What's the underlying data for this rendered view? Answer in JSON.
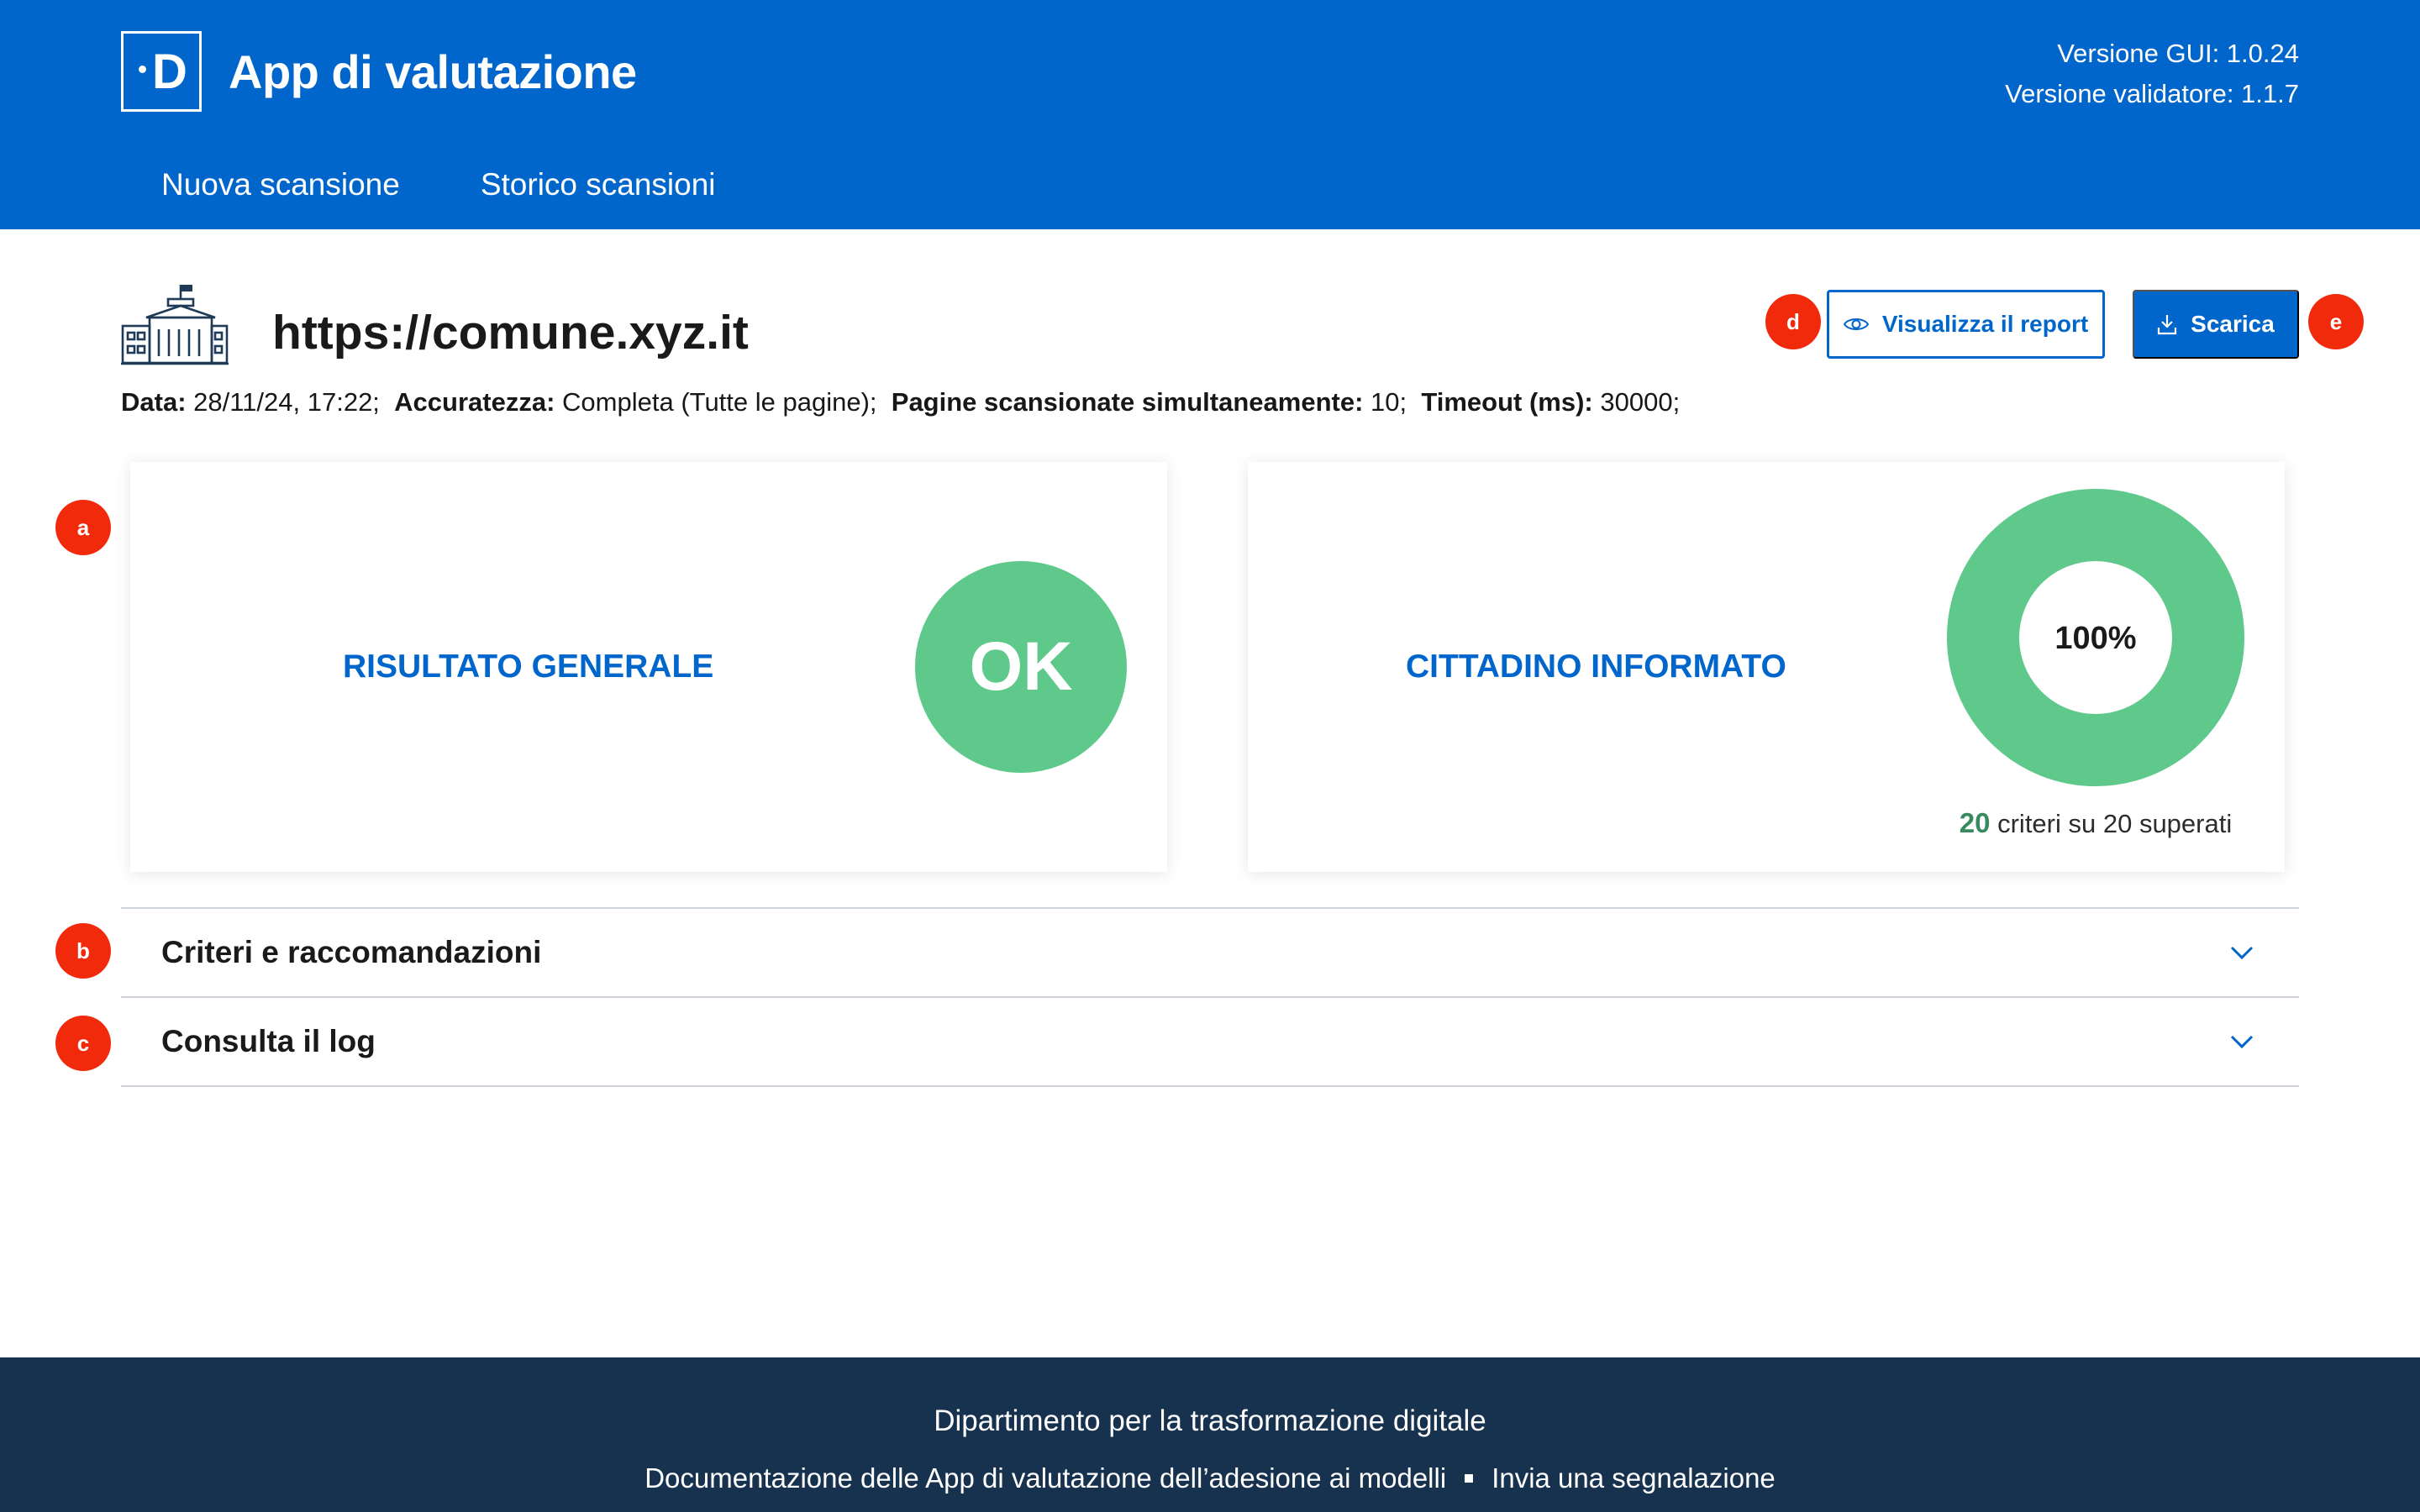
{
  "header": {
    "logo_letter": "D",
    "app_title": "App di valutazione",
    "gui_version": "Versione GUI: 1.0.24",
    "validator_version": "Versione validatore: 1.1.7",
    "nav": [
      {
        "label": "Nuova scansione"
      },
      {
        "label": "Storico scansioni"
      }
    ]
  },
  "scan": {
    "url": "https://comune.xyz.it",
    "meta": {
      "date_label": "Data:",
      "date_value": "28/11/24, 17:22;",
      "accuracy_label": "Accuratezza:",
      "accuracy_value": "Completa (Tutte le pagine);",
      "pages_label": "Pagine scansionate simultaneamente:",
      "pages_value": "10;",
      "timeout_label": "Timeout (ms):",
      "timeout_value": "30000;"
    }
  },
  "actions": {
    "view_report_label": "Visualizza il report",
    "download_label": "Scarica"
  },
  "markers": {
    "a": "a",
    "b": "b",
    "c": "c",
    "d": "d",
    "e": "e"
  },
  "cards": {
    "general": {
      "title": "RISULTATO GENERALE",
      "result": "OK"
    },
    "citizen": {
      "title": "CITTADINO INFORMATO",
      "percent_label": "100%",
      "percent": 100,
      "passed": "20",
      "criteria_text": "criteri su 20 superati"
    }
  },
  "accordion": [
    {
      "label": "Criteri e raccomandazioni"
    },
    {
      "label": "Consulta il log"
    }
  ],
  "footer": {
    "title": "Dipartimento per la trasformazione digitale",
    "link_docs": "Documentazione delle App di valutazione dell’adesione ai modelli",
    "link_report": "Invia una segnalazione"
  },
  "colors": {
    "brand_blue": "#0066cc",
    "success_green": "#5ec98b",
    "marker_red": "#f22a0c",
    "footer_navy": "#17324f"
  },
  "icons": {
    "building": "building-icon",
    "view": "eye-icon",
    "download": "download-icon",
    "expand": "chevron-down-icon"
  }
}
